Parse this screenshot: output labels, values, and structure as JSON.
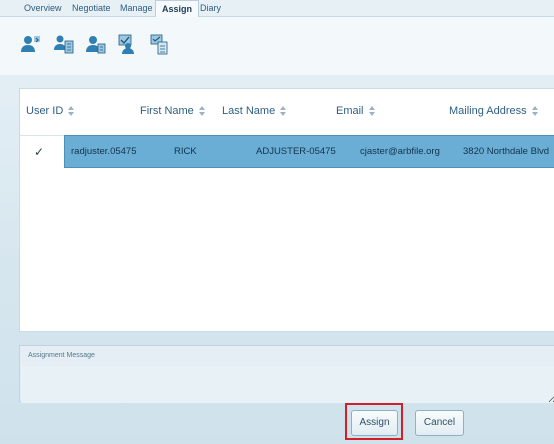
{
  "tabs": [
    {
      "label": "Overview"
    },
    {
      "label": "Negotiate"
    },
    {
      "label": "Manage"
    },
    {
      "label": "Assign"
    },
    {
      "label": "Diary"
    }
  ],
  "active_tab": "Assign",
  "toolbar": {
    "icons": [
      "assign-user-icon",
      "assign-building-icon",
      "assign-user-alt-icon",
      "assign-approve-icon",
      "assign-document-icon"
    ]
  },
  "table": {
    "columns": [
      {
        "label": "User ID"
      },
      {
        "label": "First Name"
      },
      {
        "label": "Last Name"
      },
      {
        "label": "Email"
      },
      {
        "label": "Mailing Address"
      }
    ],
    "rows": [
      {
        "selected": true,
        "check": "✓",
        "user_id": "radjuster.05475",
        "first_name": "RICK",
        "last_name": "ADJUSTER-05475",
        "email": "cjaster@arbfile.org",
        "mailing_address": "3820 Northdale Blvd"
      }
    ]
  },
  "assignment_message": {
    "label": "Assignment Message",
    "value": ""
  },
  "buttons": {
    "assign": "Assign",
    "cancel": "Cancel"
  },
  "colors": {
    "selected_row": "#6aaed6",
    "highlight": "#d0202a",
    "tab_text": "#2d5d7f"
  }
}
